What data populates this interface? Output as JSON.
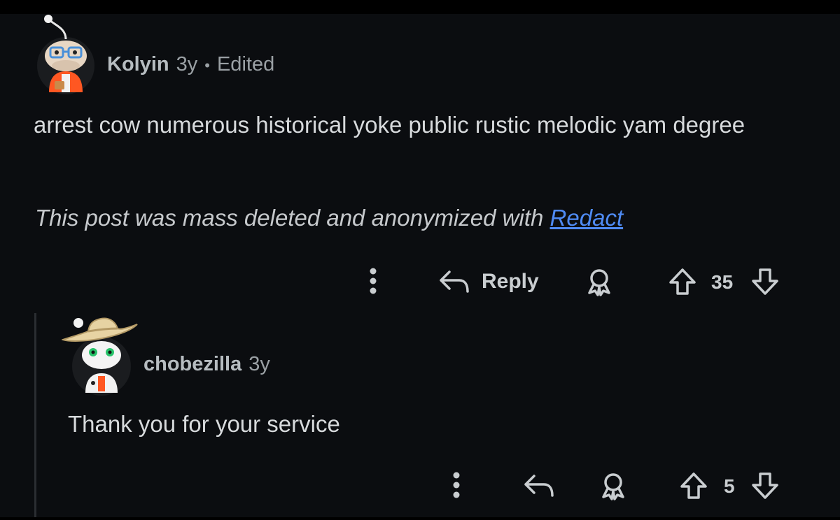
{
  "comment": {
    "username": "Kolyin",
    "age": "3y",
    "separator": "•",
    "edited": "Edited",
    "body": "arrest cow numerous historical yoke public rustic melodic yam degree",
    "note_prefix": "This post was mass deleted and anonymized with ",
    "note_link": "Redact",
    "reply_label": "Reply",
    "score": "35"
  },
  "reply": {
    "username": "chobezilla",
    "age": "3y",
    "body": "Thank you for your service",
    "score": "5"
  },
  "colors": {
    "background": "#0b0d10",
    "link": "#4f8bf4",
    "avatar_accent": "#ff5722"
  }
}
